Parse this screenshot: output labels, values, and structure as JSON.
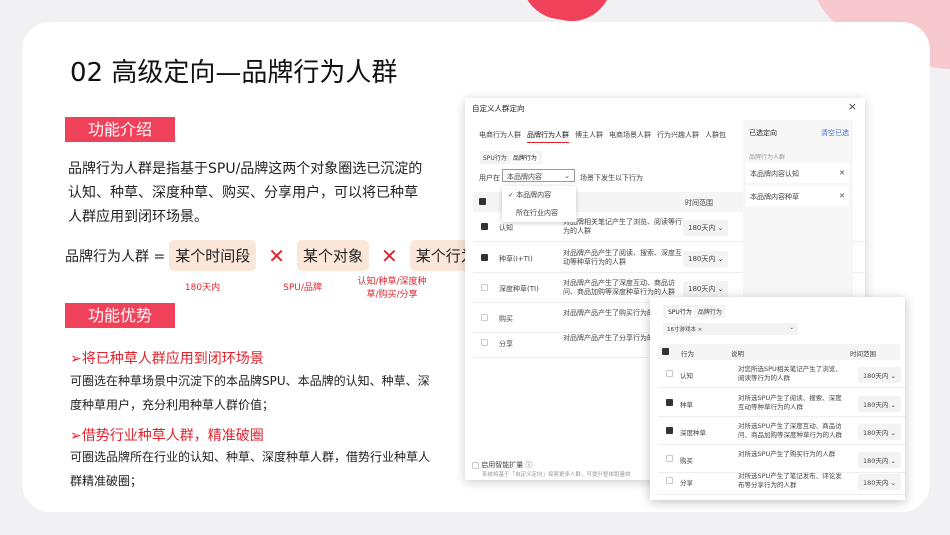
{
  "title": "02 高级定向—品牌行为人群",
  "intro": {
    "label": "功能介绍",
    "text": "品牌行为人群是指基于SPU/品牌这两个对象圈选已沉淀的认知、种草、深度种草、购买、分享用户，可以将已种草人群应用到闭环场景。"
  },
  "formula": {
    "lhs": "品牌行为人群 =",
    "terms": [
      "某个时间段",
      "某个对象",
      "某个行为"
    ],
    "op": "✕",
    "notes": [
      "180天内",
      "SPU/品牌",
      "认知/种草/深度种草/购买/分享"
    ]
  },
  "advantages": {
    "label": "功能优势",
    "items": [
      {
        "head": "➢将已种草人群应用到闭环场景",
        "text": "可圈选在种草场景中沉淀下的本品牌SPU、本品牌的认知、种草、深度种草用户，充分利用种草人群价值；"
      },
      {
        "head": "➢借势行业种草人群，精准破圈",
        "text": "可圈选品牌所在行业的认知、种草、深度种草人群，借势行业种草人群精准破圈；"
      }
    ]
  },
  "dialog": {
    "title": "自定义人群定向",
    "close": "×",
    "tabs": [
      "电商行为人群",
      "品牌行为人群",
      "博主人群",
      "电商场景人群",
      "行为兴趣人群",
      "人群包"
    ],
    "subtabs": [
      "SPU行为",
      "品牌行为"
    ],
    "user_in": "用户在",
    "select": "本品牌内容",
    "after": "场景下发生以下行为",
    "options": [
      "本品牌内容",
      "所在行业内容"
    ],
    "col_time": "时间范围",
    "rows": [
      {
        "name": "认知",
        "desc": "对品牌相关笔记产生了浏览、阅读等行为的人群",
        "time": "180天内",
        "checked": true
      },
      {
        "name": "种草(I+TI)",
        "desc": "对品牌产品产生了阅读、搜索、深度互动等种草行为的人群",
        "time": "180天内",
        "checked": true
      },
      {
        "name": "深度种草(TI)",
        "desc": "对品牌产品产生了深度互动、商品访问、商品加购等深度种草行为的人群",
        "time": "180天内",
        "checked": false
      },
      {
        "name": "购买",
        "desc": "对品牌产品产生了购买行为的人群",
        "checked": false
      },
      {
        "name": "分享",
        "desc": "对品牌产品产生了分享行为的人群",
        "checked": false
      }
    ],
    "selected_title": "已选定向",
    "clear": "清空已选",
    "group": "品牌行为人群",
    "selected": [
      "本品牌内容认知",
      "本品牌内容种草"
    ],
    "expand": "启用智能扩量",
    "expand_note": "系统将基于「自定义定向」探索更多人群，可提升整体跑量效"
  },
  "dialog2": {
    "subtabs": [
      "SPU行为",
      "品牌行为"
    ],
    "tag": "16寸游戏本 ×",
    "cols": [
      "行为",
      "说明",
      "时间范围"
    ],
    "rows": [
      {
        "name": "认知",
        "desc": "对您所选SPU相关笔记产生了浏览、阅读等行为的人群",
        "time": "180天内",
        "checked": false
      },
      {
        "name": "种草",
        "desc": "对所选SPU产生了阅读、搜索、深度互动等种草行为的人群",
        "time": "180天内",
        "checked": true
      },
      {
        "name": "深度种草",
        "desc": "对所选SPU产生了深度互动、商品访问、商品加购等深度种草行为的人群",
        "time": "180天内",
        "checked": true
      },
      {
        "name": "购买",
        "desc": "对所选SPU产生了购买行为的人群",
        "time": "180天内",
        "checked": false
      },
      {
        "name": "分享",
        "desc": "对所选SPU产生了笔记发布、评论发布等分享行为的人群",
        "time": "180天内",
        "checked": false
      }
    ]
  }
}
